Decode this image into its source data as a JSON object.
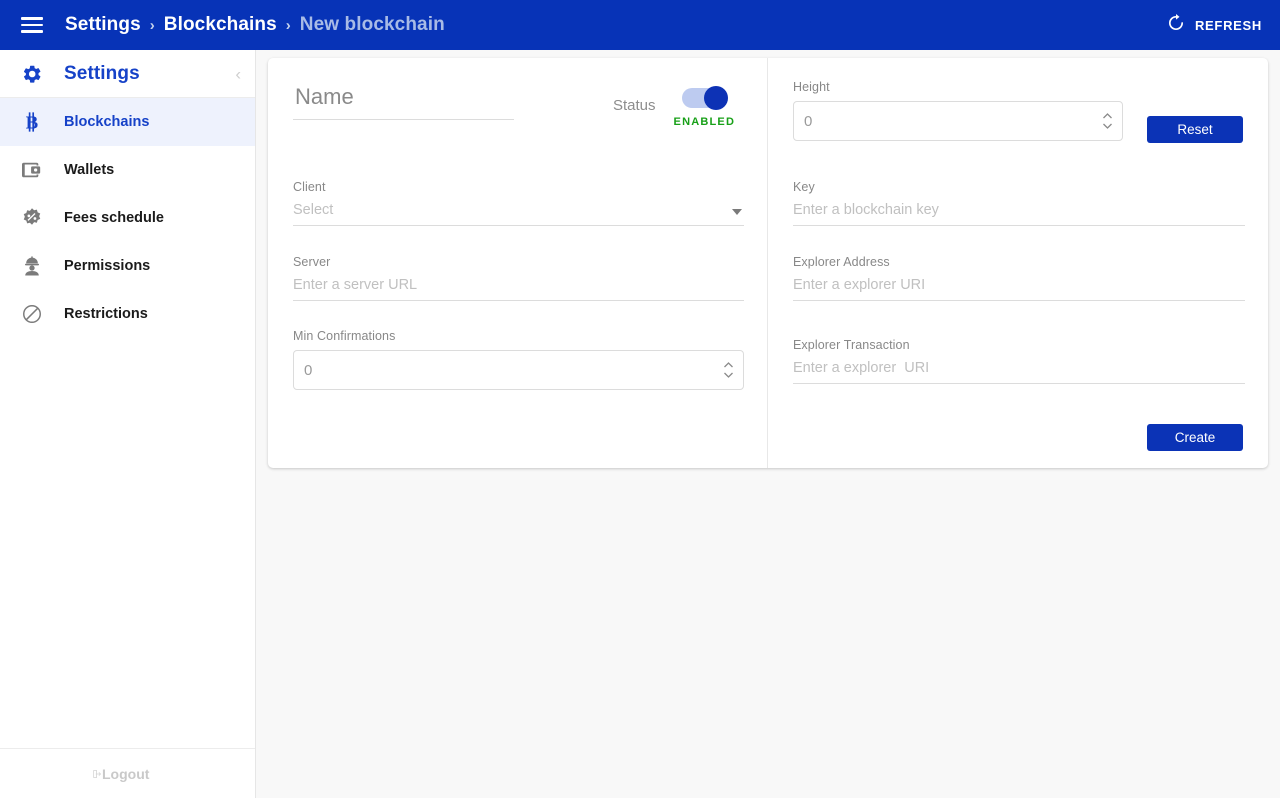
{
  "appbar": {
    "menu_icon": "hamburger-icon",
    "breadcrumbs": [
      {
        "label": "Settings",
        "current": false
      },
      {
        "label": "Blockchains",
        "current": false
      },
      {
        "label": "New blockchain",
        "current": true
      }
    ],
    "separator": "›",
    "refresh_label": "REFRESH",
    "refresh_icon": "refresh-icon",
    "background_color": "#0733b7"
  },
  "sidebar": {
    "title": "Settings",
    "title_icon": "gear-icon",
    "collapse_icon": "chevron-left-icon",
    "accent_color": "#1642c8",
    "active_background": "#eef2fd",
    "items": [
      {
        "label": "Blockchains",
        "icon": "bitcoin-icon",
        "active": true
      },
      {
        "label": "Wallets",
        "icon": "wallet-icon",
        "active": false
      },
      {
        "label": "Fees schedule",
        "icon": "percent-badge-icon",
        "active": false
      },
      {
        "label": "Permissions",
        "icon": "engineer-icon",
        "active": false
      },
      {
        "label": "Restrictions",
        "icon": "no-entry-icon",
        "active": false
      }
    ],
    "footer": {
      "label": "Logout",
      "icon": "logout-icon",
      "disabled": true
    }
  },
  "form": {
    "name": {
      "label": "",
      "placeholder": "Name",
      "value": ""
    },
    "status": {
      "label": "Status",
      "state_text": "ENABLED",
      "enabled": true,
      "on_color": "#18a018"
    },
    "client": {
      "label": "Client",
      "placeholder": "Select",
      "value": ""
    },
    "server": {
      "label": "Server",
      "placeholder": "Enter a server URL",
      "value": ""
    },
    "min_confirmations": {
      "label": "Min Confirmations",
      "placeholder": "0",
      "value": ""
    },
    "height": {
      "label": "Height",
      "placeholder": "0",
      "value": ""
    },
    "key": {
      "label": "Key",
      "placeholder": "Enter a blockchain key",
      "value": ""
    },
    "explorer_address": {
      "label": "Explorer Address",
      "placeholder": "Enter a explorer URI",
      "value": ""
    },
    "explorer_transaction": {
      "label": "Explorer Transaction",
      "placeholder": "Enter a explorer  URI",
      "value": ""
    },
    "reset_button": "Reset",
    "create_button": "Create",
    "button_color": "#0b33b6"
  }
}
